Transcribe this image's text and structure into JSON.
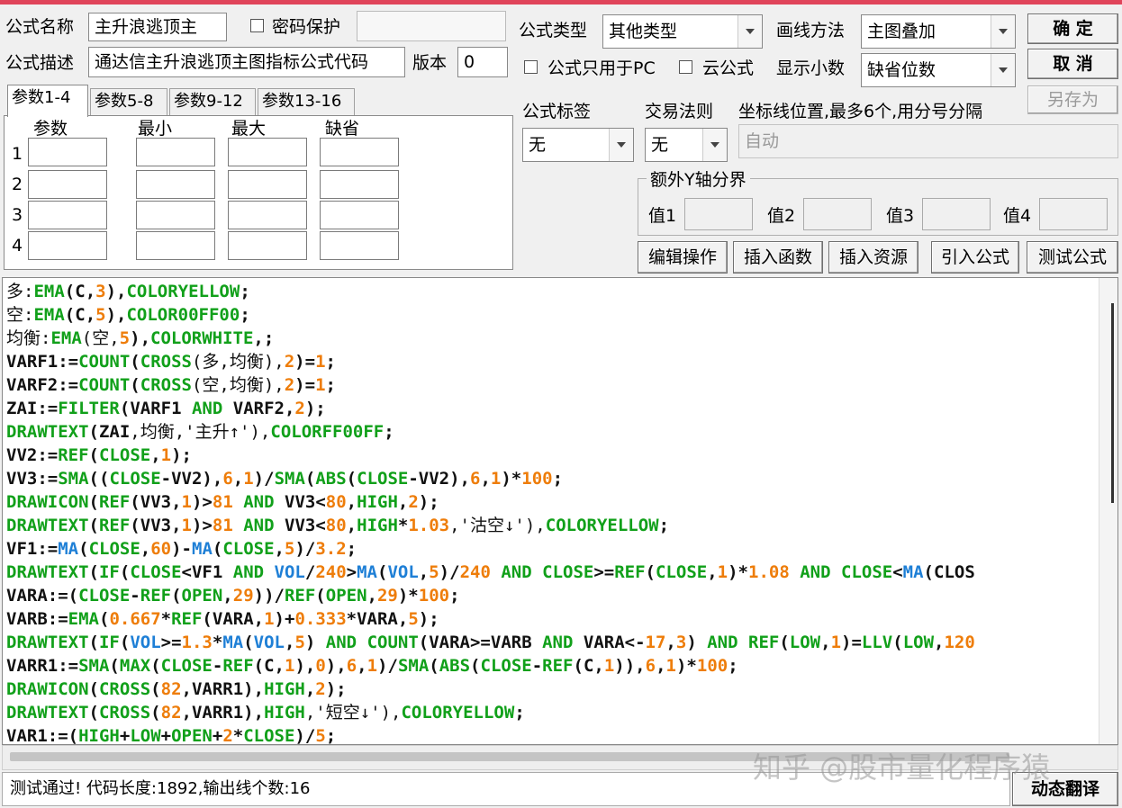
{
  "header": {
    "name_label": "公式名称",
    "name_value": "主升浪逃顶主",
    "password_label": "密码保护",
    "desc_label": "公式描述",
    "desc_value": "通达信主升浪逃顶主图指标公式代码",
    "version_label": "版本",
    "version_value": "0",
    "type_label": "公式类型",
    "type_value": "其他类型",
    "draw_label": "画线方法",
    "draw_value": "主图叠加",
    "pc_only_label": "公式只用于PC",
    "cloud_label": "云公式",
    "decimals_label": "显示小数",
    "decimals_value": "缺省位数",
    "tag_label": "公式标签",
    "tag_value": "无",
    "rule_label": "交易法则",
    "rule_value": "无",
    "coord_label": "坐标线位置,最多6个,用分号分隔",
    "coord_value": "自动",
    "extra_y_label": "额外Y轴分界",
    "y_values": [
      "值1",
      "值2",
      "值3",
      "值4"
    ]
  },
  "buttons": {
    "ok": "确 定",
    "cancel": "取 消",
    "save_as": "另存为",
    "edit_ops": "编辑操作",
    "insert_func": "插入函数",
    "insert_res": "插入资源",
    "import_formula": "引入公式",
    "test_formula": "测试公式",
    "dyn_translate": "动态翻译"
  },
  "params": {
    "tabs": [
      "参数1-4",
      "参数5-8",
      "参数9-12",
      "参数13-16"
    ],
    "columns": [
      "参数",
      "最小",
      "最大",
      "缺省"
    ],
    "rows": [
      "1",
      "2",
      "3",
      "4"
    ]
  },
  "code_lines": [
    "多:EMA(C,3),COLORYELLOW;",
    "空:EMA(C,5),COLOR00FF00;",
    "均衡:EMA(空,5),COLORWHITE,;",
    "VARF1:=COUNT(CROSS(多,均衡),2)=1;",
    "VARF2:=COUNT(CROSS(空,均衡),2)=1;",
    "ZAI:=FILTER(VARF1 AND VARF2,2);",
    "DRAWTEXT(ZAI,均衡,'主升↑'),COLORFF00FF;",
    "VV2:=REF(CLOSE,1);",
    "VV3:=SMA((CLOSE-VV2),6,1)/SMA(ABS(CLOSE-VV2),6,1)*100;",
    "DRAWICON(REF(VV3,1)>81 AND VV3<80,HIGH,2);",
    "DRAWTEXT(REF(VV3,1)>81 AND VV3<80,HIGH*1.03,'沽空↓'),COLORYELLOW;",
    "VF1:=MA(CLOSE,60)-MA(CLOSE,5)/3.2;",
    "DRAWTEXT(IF(CLOSE<VF1 AND VOL/240>MA(VOL,5)/240 AND CLOSE>=REF(CLOSE,1)*1.08 AND CLOSE<MA(CLOS",
    "VARA:=(CLOSE-REF(OPEN,29))/REF(OPEN,29)*100;",
    "VARB:=EMA(0.667*REF(VARA,1)+0.333*VARA,5);",
    "DRAWTEXT(IF(VOL>=1.3*MA(VOL,5) AND COUNT(VARA>=VARB AND VARA<-17,3) AND REF(LOW,1)=LLV(LOW,120",
    "VARR1:=SMA(MAX(CLOSE-REF(C,1),0),6,1)/SMA(ABS(CLOSE-REF(C,1)),6,1)*100;",
    "DRAWICON(CROSS(82,VARR1),HIGH,2);",
    "DRAWTEXT(CROSS(82,VARR1),HIGH,'短空↓'),COLORYELLOW;",
    "VAR1:=(HIGH+LOW+OPEN+2*CLOSE)/5;"
  ],
  "syntax_colors": {
    "function": "#11a01a",
    "number": "#ee7d0a",
    "variable": "#111111",
    "blue_func": "#1e7fd6"
  },
  "status_text": "测试通过! 代码长度:1892,输出线个数:16",
  "watermark": "知乎 @股市量化程序猿"
}
